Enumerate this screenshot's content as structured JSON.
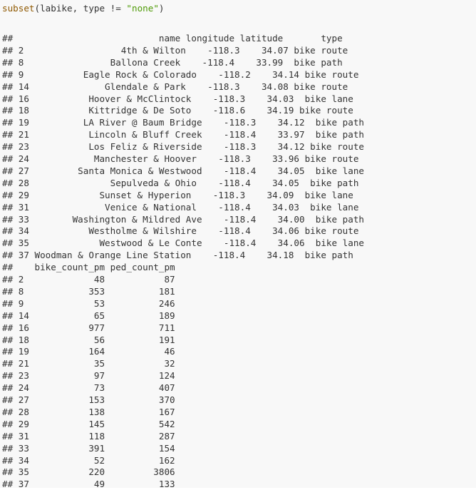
{
  "code": {
    "fn": "subset",
    "args": "(labike, type != ",
    "string": "\"none\"",
    "close": ")"
  },
  "header1": "##                           name longitude latitude       type",
  "rows1": [
    "## 2                  4th & Wilton    -118.3    34.07 bike route",
    "## 8                Ballona Creek    -118.4    33.99  bike path",
    "## 9           Eagle Rock & Colorado    -118.2    34.14 bike route",
    "## 14              Glendale & Park    -118.3    34.08 bike route",
    "## 16           Hoover & McClintock    -118.3    34.03  bike lane",
    "## 18           Kittridge & De Soto    -118.6    34.19 bike route",
    "## 19          LA River @ Baum Bridge    -118.3    34.12  bike path",
    "## 21           Lincoln & Bluff Creek    -118.4    33.97  bike path",
    "## 23           Los Feliz & Riverside    -118.3    34.12 bike route",
    "## 24            Manchester & Hoover    -118.3    33.96 bike route",
    "## 27         Santa Monica & Westwood    -118.4    34.05  bike lane",
    "## 28               Sepulveda & Ohio    -118.4    34.05  bike path",
    "## 29             Sunset & Hyperion    -118.3    34.09  bike lane",
    "## 31              Venice & National    -118.4    34.03  bike lane",
    "## 33        Washington & Mildred Ave    -118.4    34.00  bike path",
    "## 34           Westholme & Wilshire    -118.4    34.06 bike route",
    "## 35             Westwood & Le Conte    -118.4    34.06  bike lane",
    "## 37 Woodman & Orange Line Station    -118.4    34.18  bike path"
  ],
  "header2": "##    bike_count_pm ped_count_pm",
  "rows2": [
    "## 2             48           87",
    "## 8            353          181",
    "## 9             53          246",
    "## 14            65          189",
    "## 16           977          711",
    "## 18            56          191",
    "## 19           164           46",
    "## 21            35           32",
    "## 23            97          124",
    "## 24            73          407",
    "## 27           153          370",
    "## 28           138          167",
    "## 29           145          542",
    "## 31           118          287",
    "## 33           391          154",
    "## 34            52          162",
    "## 35           220         3806",
    "## 37            49          133"
  ]
}
